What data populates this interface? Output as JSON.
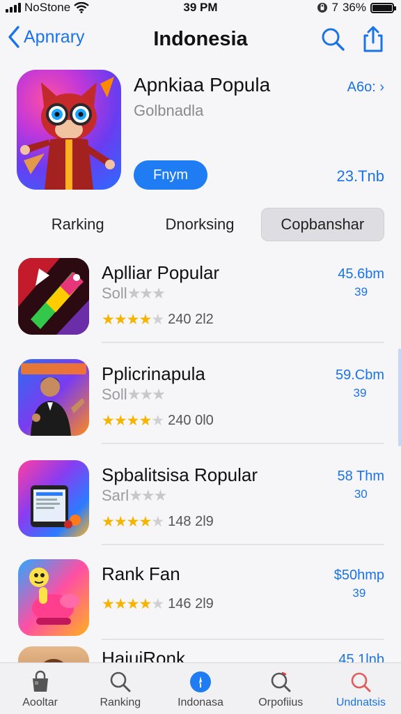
{
  "status_bar": {
    "carrier": "NoStone",
    "time": "39 PM",
    "battery": "36%",
    "battery_level": 0.36,
    "extra": "7"
  },
  "nav": {
    "back_label": "Apnrary",
    "title": "Indonesia",
    "icons": [
      "search-icon",
      "share-icon"
    ]
  },
  "featured": {
    "title": "Apnkiaa Popula",
    "subtitle": "Golbnadla",
    "button_label": "Fnym",
    "age_label": "A6o:",
    "size": "23.Tnb",
    "icon": "fox-character-app-icon"
  },
  "segments": {
    "items": [
      {
        "label": "Rarking",
        "active": false
      },
      {
        "label": "Dnorksing",
        "active": false
      },
      {
        "label": "Copbanshar",
        "active": true
      }
    ]
  },
  "apps": [
    {
      "title": "Aplliar Popular",
      "subtitle": "Soll",
      "rating_count": "240 2l2",
      "stars": 4.5,
      "price": "45.6bm",
      "price_sub": "39",
      "icon": "pencil-game-icon"
    },
    {
      "title": "Pplicrinapula",
      "subtitle": "Soll",
      "rating_count": "240 0l0",
      "stars": 4.5,
      "price": "59.Cbm",
      "price_sub": "39",
      "icon": "man-portrait-icon"
    },
    {
      "title": "Spbalitsisa Ropular",
      "subtitle": "Sarl",
      "rating_count": "148 2l9",
      "stars": 4.5,
      "price": "58 Thm",
      "price_sub": "30",
      "icon": "tablet-app-icon"
    },
    {
      "title": "Rank Fan",
      "subtitle": "",
      "rating_count": "146 2l9",
      "stars": 4.5,
      "price": "$50hmp",
      "price_sub": "39",
      "icon": "cartoon-character-icon"
    },
    {
      "title": "HaiuiRonk",
      "subtitle": "",
      "rating_count": "",
      "stars": 0,
      "price": "45 1lnb",
      "price_sub": "",
      "icon": "person-avatar-icon"
    }
  ],
  "tabbar": {
    "items": [
      {
        "label": "Aooltar",
        "icon": "store-bag-icon",
        "active": false
      },
      {
        "label": "Ranking",
        "icon": "search-icon",
        "active": false
      },
      {
        "label": "Indonasa",
        "icon": "compass-icon",
        "active": false
      },
      {
        "label": "Orpofiius",
        "icon": "search-refresh-icon",
        "active": false
      },
      {
        "label": "Undnatsis",
        "icon": "search-icon",
        "active": true
      }
    ]
  },
  "colors": {
    "accent": "#1a73e8",
    "button": "#1f7cf2",
    "star": "#f5b400"
  }
}
